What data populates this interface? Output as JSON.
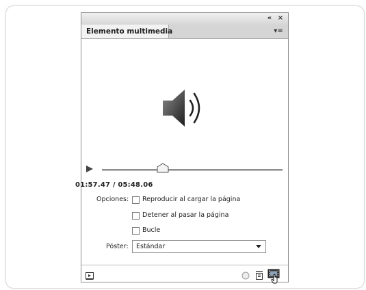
{
  "window": {
    "collapse_glyph": "«",
    "close_glyph": "×"
  },
  "panel": {
    "tab_title": "Elemento multimedia",
    "menu_glyph": "▾≡"
  },
  "playback": {
    "time": "01:57.47 / 05:48.06",
    "progress_fraction": 0.337
  },
  "options": {
    "label": "Opciones:",
    "items": [
      {
        "label": "Reproducir al cargar la página",
        "checked": false
      },
      {
        "label": "Detener al pasar la página",
        "checked": false
      },
      {
        "label": "Bucle",
        "checked": false
      }
    ]
  },
  "poster": {
    "label": "Póster:",
    "selected": "Estándar"
  },
  "icons": {
    "speaker": "speaker-volume-icon",
    "play": "play-icon",
    "preview": "preview-panel-icon",
    "record": "record-circle-icon",
    "url": "open-url-icon",
    "media": "film-media-icon"
  }
}
